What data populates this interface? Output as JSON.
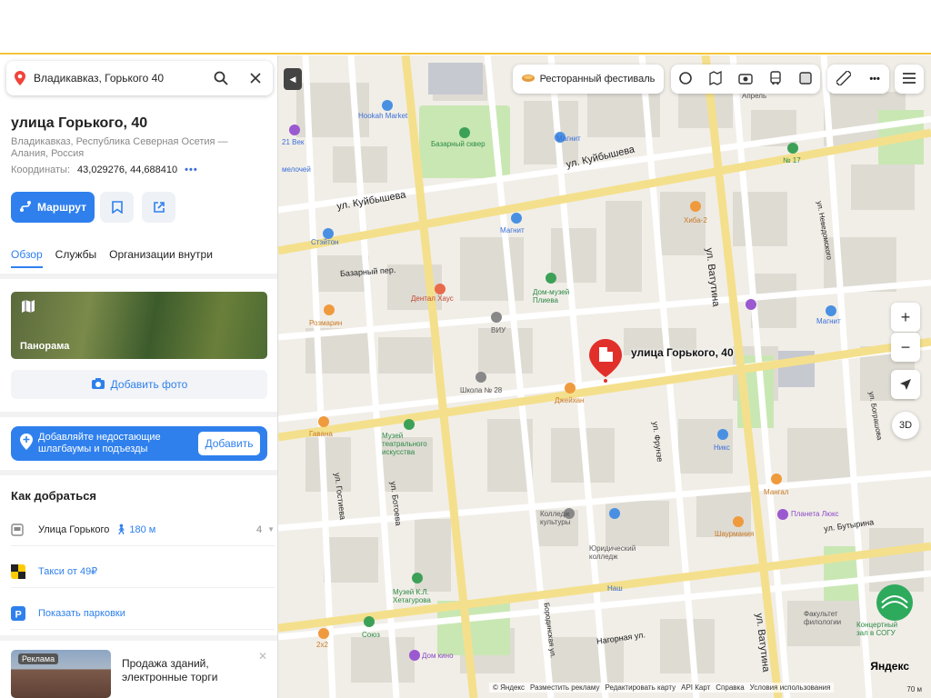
{
  "search": {
    "value": "Владикавказ, Горького 40"
  },
  "place": {
    "title": "улица Горького, 40",
    "subtitle": "Владикавказ, Республика Северная Осетия — Алания, Россия",
    "coords_label": "Координаты:",
    "coords_value": "43,029276, 44,688410"
  },
  "actions": {
    "route": "Маршрут"
  },
  "tabs": [
    "Обзор",
    "Службы",
    "Организации внутри"
  ],
  "panorama": {
    "label": "Панорама"
  },
  "add_photo": "Добавить фото",
  "banner": {
    "text": "Добавляйте недостающие шлагбаумы и подъезды",
    "button": "Добавить"
  },
  "howto": {
    "title": "Как добраться",
    "stop": "Улица Горького",
    "walk": "180 м",
    "count": "4",
    "taxi": "Такси от 49₽",
    "parking": "Показать парковки"
  },
  "ad": {
    "tag": "Реклама",
    "text": "Продажа зданий, электронные торги"
  },
  "map": {
    "promo": "Ресторанный фестиваль",
    "marker_label": "улица Горького, 40",
    "zoom_in": "+",
    "zoom_out": "−",
    "btn_3d": "3D",
    "logo": "Яндекс",
    "scale": "70 м",
    "footer": [
      "© Яндекс",
      "Разместить рекламу",
      "Редактировать карту",
      "API Карт",
      "Справка",
      "Условия использования"
    ],
    "streets": [
      "ул. Куйбышева",
      "ул. Куйбышева",
      "ул. Ватутина",
      "ул. Ватутина",
      "ул. Фрунзе",
      "ул. Гостиева",
      "ул. Ботоева",
      "ул. Бутырина",
      "ул. Бограшова",
      "ул. Неведомского",
      "Нагорная ул.",
      "Бородинская ул.",
      "Базарный пер."
    ],
    "pois": [
      "Hookah Market",
      "Базарный сквер",
      "Магнит",
      "Магнит",
      "Магнит",
      "Стэйтон",
      "Дентал Хаус",
      "Розмарин",
      "ВИУ",
      "Дом-музей Плиева",
      "Школа № 28",
      "Джейхан",
      "Хиба-2",
      "№ 17",
      "Апрель",
      "Никс",
      "Мангал",
      "Планета Люкс",
      "Шаурмания",
      "Юридический колледж",
      "Колледж культуры",
      "Наш",
      "Музей театрального искусства",
      "Гавана",
      "Музей К.Л. Хетагурова",
      "Союз",
      "Дом кино",
      "2x2",
      "Факультет филологии",
      "Концертный зал в СОГУ",
      "21 Век",
      "мелочей"
    ]
  }
}
